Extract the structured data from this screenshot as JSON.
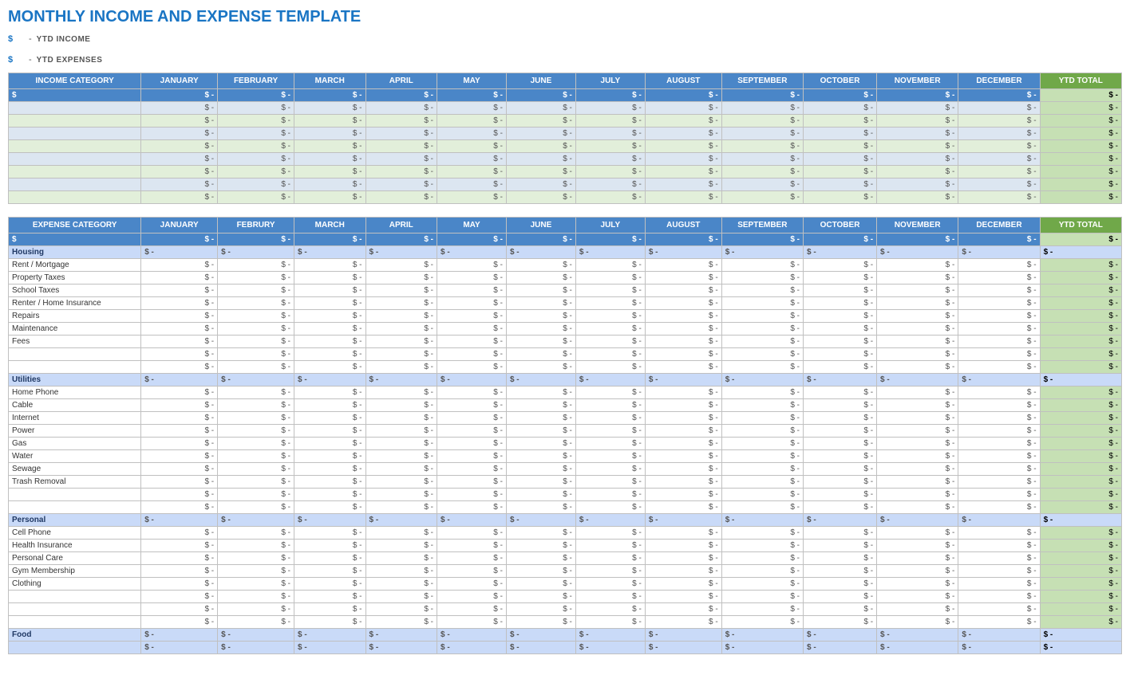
{
  "title": "MONTHLY INCOME AND EXPENSE TEMPLATE",
  "ytd_income_label": "YTD INCOME",
  "ytd_expenses_label": "YTD EXPENSES",
  "dollar_symbol": "$",
  "dash": "-",
  "months": [
    "JANUARY",
    "FEBRUARY",
    "MARCH",
    "APRIL",
    "MAY",
    "JUNE",
    "JULY",
    "AUGUST",
    "SEPTEMBER",
    "OCTOBER",
    "NOVEMBER",
    "DECEMBER"
  ],
  "months_expense": [
    "JANUARY",
    "FEBRURY",
    "MARCH",
    "APRIL",
    "MAY",
    "JUNE",
    "JULY",
    "AUGUST",
    "SEPTEMBER",
    "OCTOBER",
    "NOVEMBER",
    "DECEMBER"
  ],
  "ytd_total": "YTD TOTAL",
  "income_category": "INCOME CATEGORY",
  "expense_category": "EXPENSE CATEGORY",
  "income_rows": [
    {
      "label": ""
    },
    {
      "label": ""
    },
    {
      "label": ""
    },
    {
      "label": ""
    },
    {
      "label": ""
    },
    {
      "label": ""
    },
    {
      "label": ""
    },
    {
      "label": ""
    }
  ],
  "expense_sections": [
    {
      "name": "Housing",
      "items": [
        "Rent / Mortgage",
        "Property Taxes",
        "School Taxes",
        "Renter / Home Insurance",
        "Repairs",
        "Maintenance",
        "Fees",
        "",
        ""
      ]
    },
    {
      "name": "Utilities",
      "items": [
        "Home Phone",
        "Cable",
        "Internet",
        "Power",
        "Gas",
        "Water",
        "Sewage",
        "Trash Removal",
        "",
        ""
      ]
    },
    {
      "name": "Personal",
      "items": [
        "Cell Phone",
        "Health Insurance",
        "Personal Care",
        "Gym Membership",
        "Clothing",
        "",
        "",
        ""
      ]
    },
    {
      "name": "Food",
      "items": []
    }
  ]
}
